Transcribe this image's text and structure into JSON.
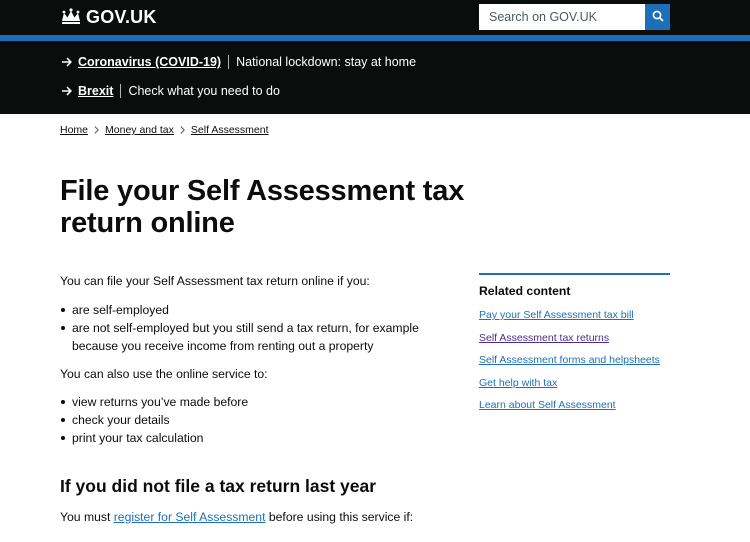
{
  "header": {
    "logo_text": "GOV.UK",
    "logo_icon": "crown-icon",
    "search_placeholder": "Search on GOV.UK",
    "search_icon": "search-icon",
    "colors": {
      "background": "#0b0c0c",
      "stripe": "#1d70b8",
      "search_button": "#1d70b8"
    }
  },
  "banner": {
    "items": [
      {
        "link": "Coronavirus (COVID-19)",
        "text": "National lockdown: stay at home"
      },
      {
        "link": "Brexit",
        "text": "Check what you need to do"
      }
    ]
  },
  "breadcrumbs": [
    "Home",
    "Money and tax",
    "Self Assessment"
  ],
  "main": {
    "title": "File your Self Assessment tax return online",
    "intro": "You can file your Self Assessment tax return online if you:",
    "list1": [
      "are self-employed",
      "are not self-employed but you still send a tax return, for example because you receive income from renting out a property"
    ],
    "also": "You can also use the online service to:",
    "list2": [
      "view returns you’ve made before",
      "check your details",
      "print your tax calculation"
    ],
    "heading2": "If you did not file a tax return last year",
    "must_prefix": "You must ",
    "must_link": "register for Self Assessment",
    "must_suffix": " before using this service if:"
  },
  "related": {
    "title": "Related content",
    "links": [
      "Pay your Self Assessment tax bill",
      "Self Assessment tax returns",
      "Self Assessment forms and helpsheets",
      "Get help with tax",
      "Learn about Self Assessment"
    ],
    "link_color": "#1d70b8",
    "visited_color": "#4c2c92"
  }
}
